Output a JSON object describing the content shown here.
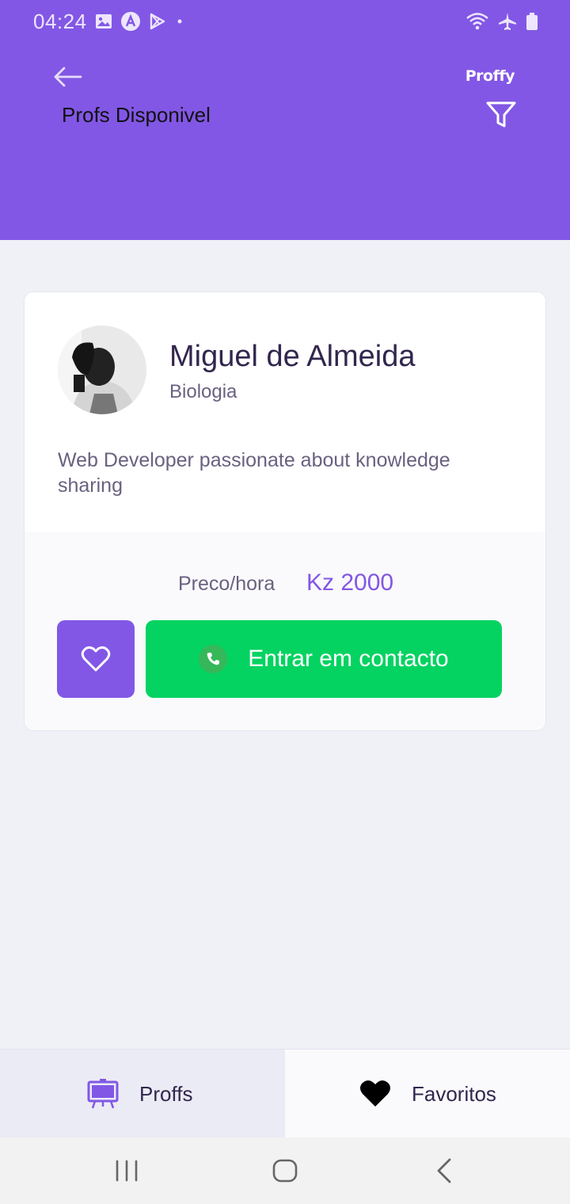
{
  "status_bar": {
    "time": "04:24",
    "left_icons": [
      "image-icon",
      "app-a-icon",
      "play-store-icon",
      "dot-icon"
    ],
    "right_icons": [
      "wifi-icon",
      "airplane-icon",
      "battery-icon"
    ]
  },
  "header": {
    "brand": "Proffy",
    "title": "Profs Disponivel"
  },
  "teacher": {
    "name": "Miguel de Almeida",
    "subject": "Biologia",
    "bio": "Web Developer passionate about knowledge sharing",
    "price_label": "Preco/hora",
    "price_value": "Kz 2000",
    "contact_label": "Entrar em contacto"
  },
  "tabs": [
    {
      "label": "Proffs",
      "icon": "easel-icon",
      "active": true
    },
    {
      "label": "Favoritos",
      "icon": "heart-icon",
      "active": false
    }
  ],
  "colors": {
    "primary": "#8257E5",
    "secondary": "#04D361",
    "background": "#F0F0F7",
    "text_title": "#32264D",
    "text_body": "#6A6180"
  }
}
